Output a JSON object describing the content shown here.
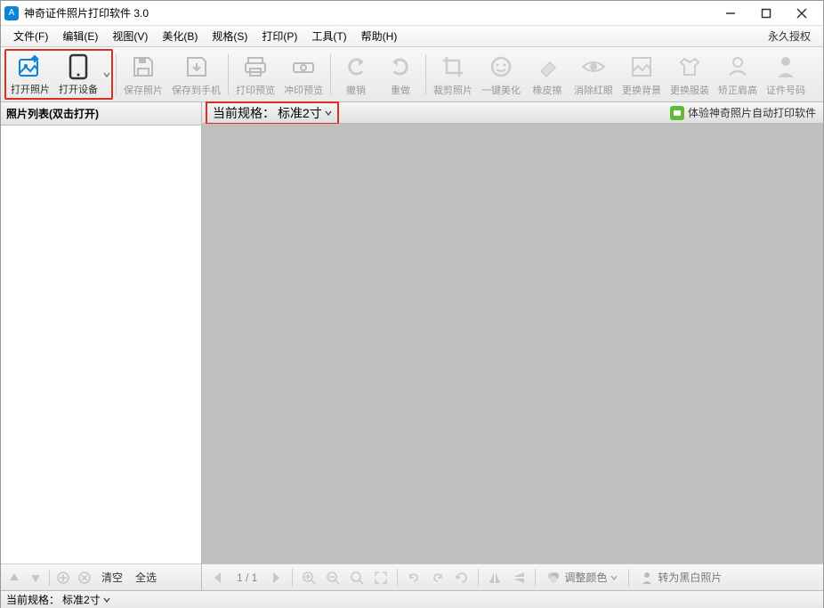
{
  "title": "神奇证件照片打印软件 3.0",
  "license": "永久授权",
  "menu": [
    "文件(F)",
    "编辑(E)",
    "视图(V)",
    "美化(B)",
    "规格(S)",
    "打印(P)",
    "工具(T)",
    "帮助(H)"
  ],
  "toolbar": {
    "open_photo": "打开照片",
    "open_device": "打开设备",
    "save_photo": "保存照片",
    "save_to_phone": "保存到手机",
    "print_preview": "打印预览",
    "stamp_preview": "冲印预览",
    "undo": "撤销",
    "redo": "重做",
    "crop": "裁剪照片",
    "beautify": "一键美化",
    "eraser": "橡皮擦",
    "redeye": "消除红眼",
    "change_bg": "更换背景",
    "change_clothes": "更换服装",
    "shoulder": "矫正肩高",
    "id_number": "证件号码"
  },
  "left": {
    "header": "照片列表(双击打开)",
    "clear": "清空",
    "select_all": "全选"
  },
  "spec": {
    "label": "当前规格：",
    "value": "标准2寸"
  },
  "promo": "体验神奇照片自动打印软件",
  "canvas_tools": {
    "page": "1 / 1",
    "adjust_color": "调整颜色",
    "to_bw": "转为黑白照片"
  },
  "status": {
    "label": "当前规格：",
    "value": "标准2寸"
  }
}
